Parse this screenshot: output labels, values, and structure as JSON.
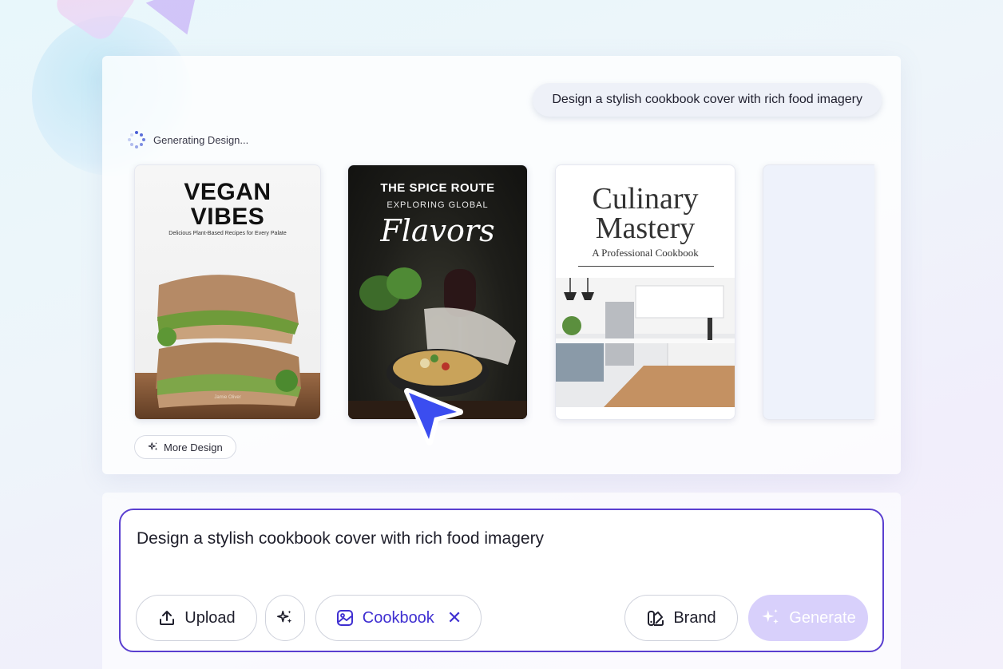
{
  "chat": {
    "prompt_bubble": "Design a stylish cookbook cover with rich food imagery",
    "status": "Generating Design..."
  },
  "designs": [
    {
      "title_line1": "VEGAN",
      "title_line2": "VIBES",
      "subtitle": "Delicious Plant-Based Recipes for Every Palate",
      "author": "Jamie Oliver"
    },
    {
      "title": "THE SPICE ROUTE",
      "subtitle": "EXPLORING GLOBAL",
      "script": "Flavors"
    },
    {
      "title_line1": "Culinary",
      "title_line2": "Mastery",
      "subtitle": "A Professional Cookbook"
    }
  ],
  "more_design_label": "More Design",
  "composer": {
    "input_value": "Design a stylish cookbook cover with rich food imagery",
    "upload_label": "Upload",
    "tag_label": "Cookbook",
    "brand_label": "Brand",
    "generate_label": "Generate"
  },
  "colors": {
    "accent": "#5a3fd0",
    "tag_text": "#3f2fd1",
    "generate_bg": "#d8d0fb",
    "cursor": "#3b4df0"
  },
  "icons": {
    "upload": "upload-icon",
    "magic": "sparkle-icon",
    "cookbook": "cookbook-image-icon",
    "close": "close-icon",
    "brand": "brand-palette-icon",
    "generate": "sparkle-icon",
    "spinner": "loading-spinner-icon",
    "cursor": "mouse-cursor-icon"
  }
}
